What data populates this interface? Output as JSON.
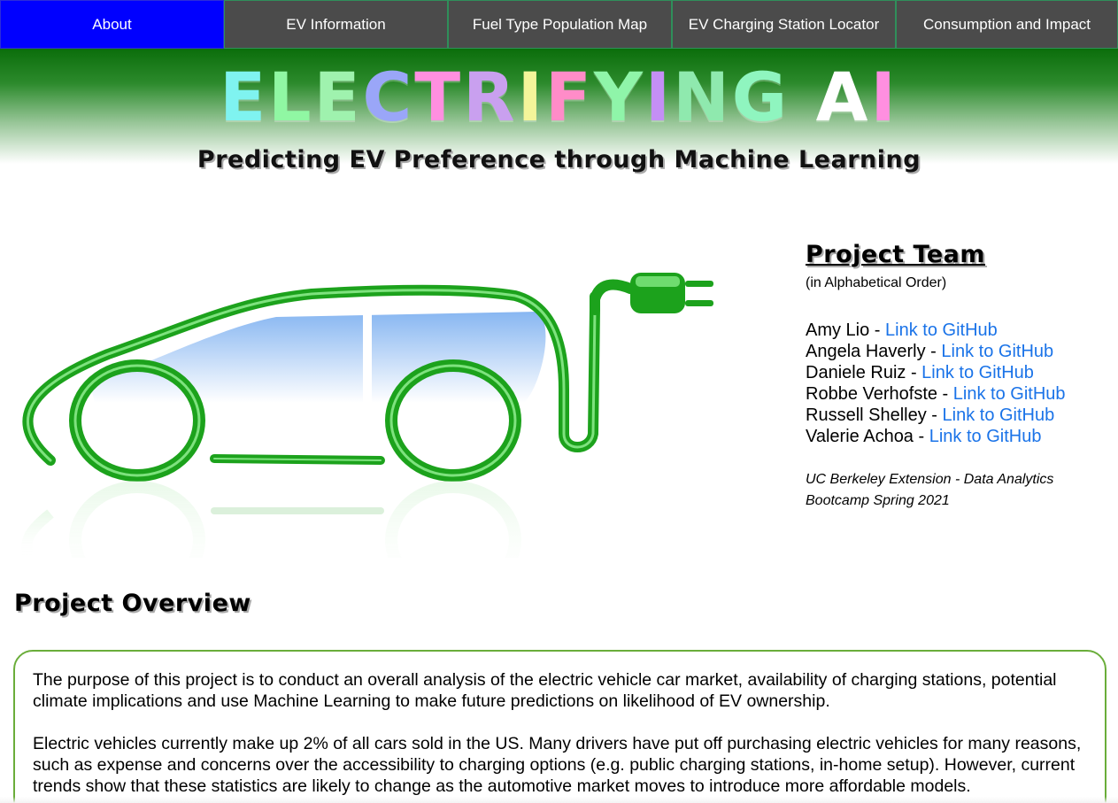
{
  "nav": {
    "items": [
      {
        "label": "About"
      },
      {
        "label": "EV Information"
      },
      {
        "label": "Fuel Type Population Map"
      },
      {
        "label": "EV Charging Station Locator"
      },
      {
        "label": "Consumption and Impact"
      }
    ],
    "active_index": 0
  },
  "hero": {
    "title": "ELECTRIFYING AI",
    "title_colors": [
      "#7ff3f0",
      "#90f7a3",
      "#9ff2ae",
      "#9aa6f8",
      "#ff8fe0",
      "#c9a0ef",
      "#f4f59a",
      "#ff8cc8",
      "#8ff5a9",
      "#c48ff5",
      "#8fe9ae",
      "#8ff5bf",
      "#9fd6f7",
      "#ffffff",
      "#ff8fe0",
      "#9ff2d9"
    ],
    "subtitle": "Predicting EV Preference through Machine Learning"
  },
  "team": {
    "heading": "Project Team",
    "order_note": "(in Alphabetical Order)",
    "members": [
      {
        "name": "Amy Lio",
        "link_label": "Link to GitHub"
      },
      {
        "name": "Angela Haverly",
        "link_label": "Link to GitHub"
      },
      {
        "name": "Daniele Ruiz",
        "link_label": "Link to GitHub"
      },
      {
        "name": "Robbe Verhofste",
        "link_label": "Link to GitHub"
      },
      {
        "name": "Russell Shelley",
        "link_label": "Link to GitHub"
      },
      {
        "name": "Valerie Achoa",
        "link_label": "Link to GitHub"
      }
    ],
    "school": "UC Berkeley Extension - Data Analytics Bootcamp Spring 2021"
  },
  "overview": {
    "heading": "Project Overview",
    "paragraphs": [
      "The purpose of this project is to conduct an overall analysis of the electric vehicle car market, availability of charging stations, potential climate implications and use Machine Learning to make future predictions on likelihood of EV ownership.",
      "Electric vehicles currently make up 2% of all cars sold in the US. Many drivers have put off purchasing electric vehicles for many reasons, such as expense and concerns over the accessibility to charging options (e.g. public charging stations, in-home setup). However, current trends show that these statistics are likely to change as the automotive market moves to introduce more affordable models."
    ]
  },
  "colors": {
    "nav_active": "#0000ff",
    "nav_bg": "#4b4b4b",
    "link": "#1a73e8",
    "car_green": "#22b022",
    "box_border": "#6aad3a"
  },
  "icons": {
    "car_illustration": "ev-car-plug-icon"
  }
}
